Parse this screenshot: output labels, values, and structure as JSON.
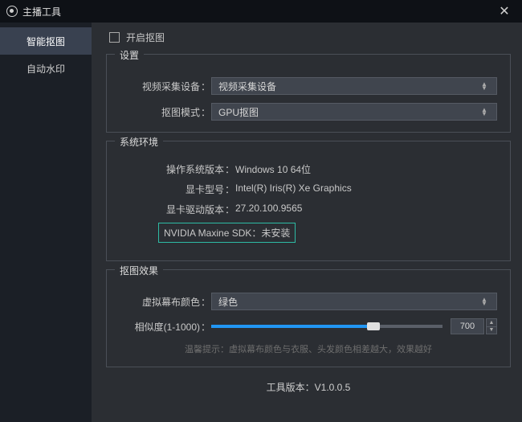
{
  "window": {
    "title": "主播工具"
  },
  "sidebar": {
    "tabs": [
      {
        "label": "智能抠图"
      },
      {
        "label": "自动水印"
      }
    ]
  },
  "enable": {
    "label": "开启抠图"
  },
  "settings": {
    "legend": "设置",
    "device_label": "视频采集设备",
    "device_value": "视频采集设备",
    "mode_label": "抠图模式",
    "mode_value": "GPU抠图"
  },
  "sysenv": {
    "legend": "系统环境",
    "os_label": "操作系统版本",
    "os_value": "Windows 10 64位",
    "gpu_label": "显卡型号",
    "gpu_value": "Intel(R) Iris(R) Xe Graphics",
    "driver_label": "显卡驱动版本",
    "driver_value": "27.20.100.9565",
    "sdk_label": "NVIDIA Maxine SDK",
    "sdk_value": "未安装"
  },
  "effect": {
    "legend": "抠图效果",
    "bgcolor_label": "虚拟幕布颜色",
    "bgcolor_value": "绿色",
    "sim_label": "相似度(1-1000)",
    "sim_value": "700",
    "sim_percent": 70,
    "hint": "温馨提示：虚拟幕布颜色与衣服、头发颜色相差越大，效果越好"
  },
  "footer": {
    "version_label": "工具版本：",
    "version_value": "V1.0.0.5"
  }
}
